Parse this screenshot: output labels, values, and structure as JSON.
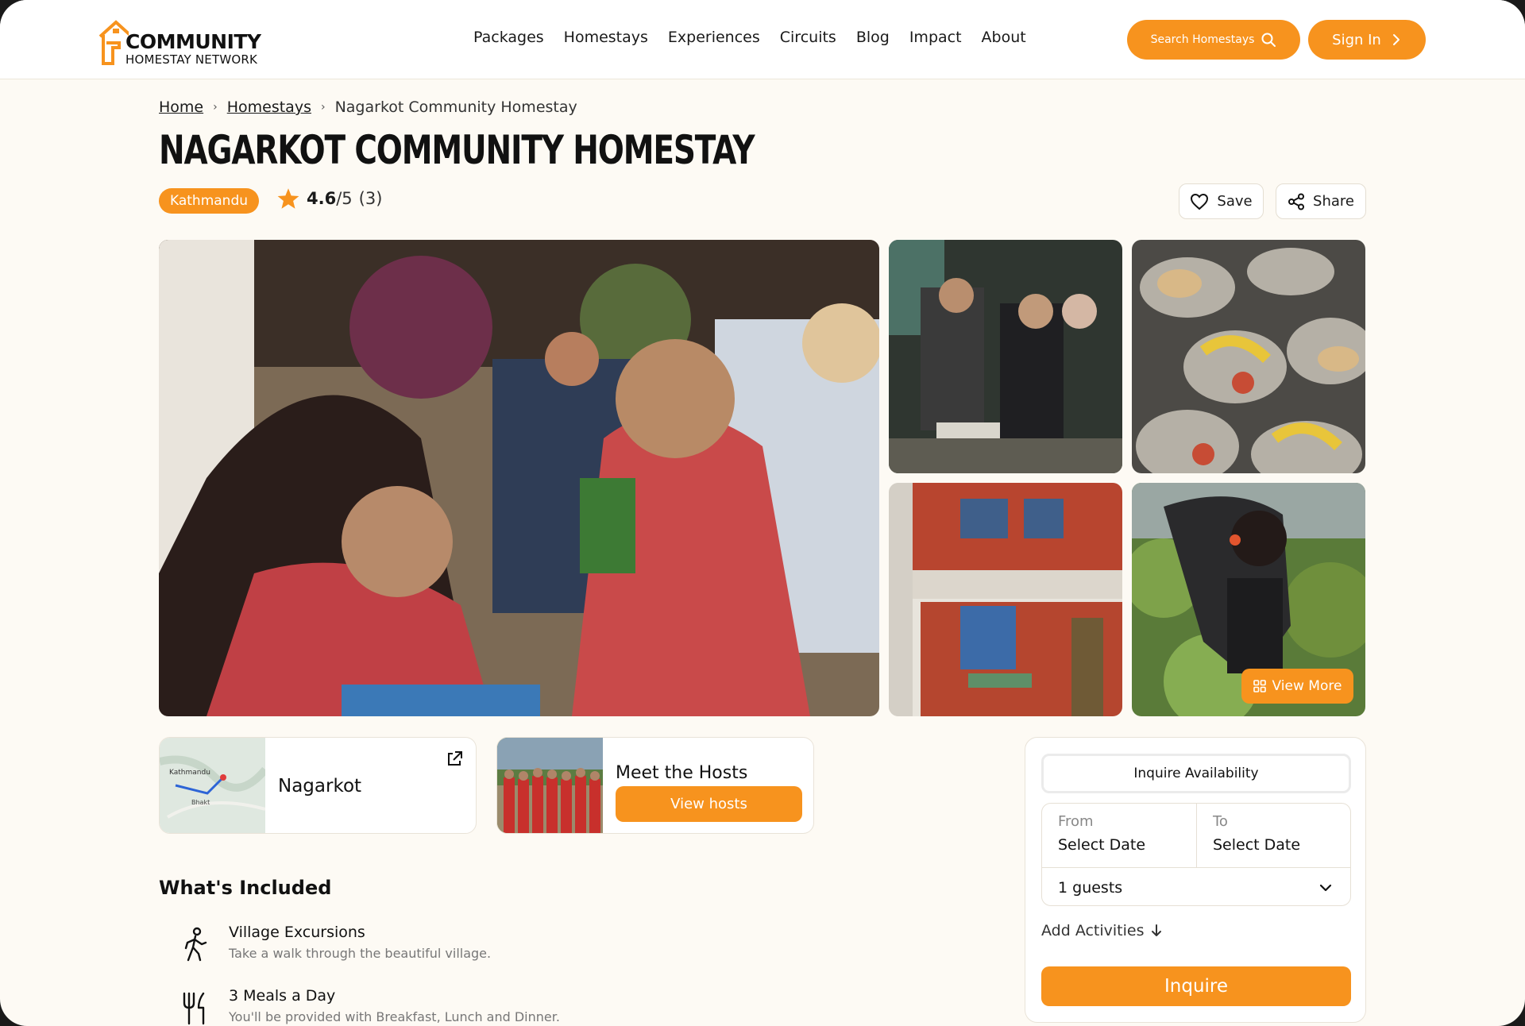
{
  "brand": {
    "name_line1": "COMMUNITY",
    "name_line2": "HOMESTAY NETWORK",
    "accent": "#f7931e"
  },
  "nav": [
    "Packages",
    "Homestays",
    "Experiences",
    "Circuits",
    "Blog",
    "Impact",
    "About"
  ],
  "header_actions": {
    "search_label": "Search Homestays",
    "signin_label": "Sign In"
  },
  "breadcrumb": {
    "home": "Home",
    "homestays": "Homestays",
    "current": "Nagarkot Community Homestay"
  },
  "listing": {
    "title": "NAGARKOT COMMUNITY HOMESTAY",
    "region": "Kathmandu",
    "rating": "4.6",
    "rating_max": "/5",
    "review_count": "(3)",
    "save_label": "Save",
    "share_label": "Share"
  },
  "gallery": {
    "photos": [
      "welcome-ceremony-photo",
      "cultural-dance-photo",
      "meal-plates-photo",
      "homestay-building-photo",
      "farm-garden-photo"
    ],
    "view_more_label": "View More"
  },
  "location_card": {
    "name": "Nagarkot",
    "map_labels": [
      "Kathmandu",
      "Bhakt"
    ]
  },
  "hosts_card": {
    "title": "Meet the Hosts",
    "button": "View hosts"
  },
  "included": {
    "heading": "What's Included",
    "items": [
      {
        "title": "Village Excursions",
        "desc": "Take a walk through the beautiful village.",
        "icon": "walking-icon"
      },
      {
        "title": "3 Meals a Day",
        "desc": "You'll be provided with Breakfast, Lunch and Dinner.",
        "icon": "fork-knife-icon"
      }
    ]
  },
  "inquiry": {
    "tab": "Inquire Availability",
    "from_label": "From",
    "from_value": "Select Date",
    "to_label": "To",
    "to_value": "Select Date",
    "guests": "1 guests",
    "add_activities": "Add Activities",
    "submit": "Inquire"
  }
}
